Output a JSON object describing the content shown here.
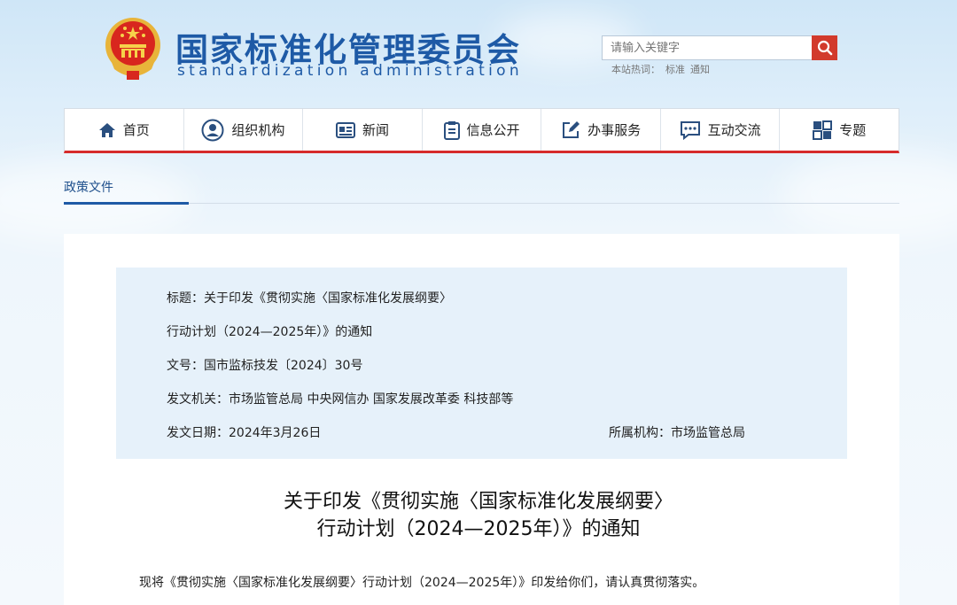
{
  "header": {
    "site_title": "国家标准化管理委员会",
    "site_subtitle": "standardization administration",
    "search_placeholder": "请输入关键字",
    "hot_label": "本站热词：",
    "hot_words": [
      "标准",
      "通知"
    ]
  },
  "nav": {
    "items": [
      {
        "label": "首页",
        "icon": "home-icon"
      },
      {
        "label": "组织机构",
        "icon": "user-circle-icon"
      },
      {
        "label": "新闻",
        "icon": "newspaper-icon"
      },
      {
        "label": "信息公开",
        "icon": "clipboard-icon"
      },
      {
        "label": "办事服务",
        "icon": "edit-icon"
      },
      {
        "label": "互动交流",
        "icon": "chat-icon"
      },
      {
        "label": "专题",
        "icon": "puzzle-icon"
      }
    ]
  },
  "breadcrumb": {
    "label": "政策文件"
  },
  "meta": {
    "title_label": "标题：",
    "title_line1": "关于印发《贯彻实施〈国家标准化发展纲要〉",
    "title_line2": "行动计划（2024—2025年）》的通知",
    "docno_label": "文号：",
    "docno": "国市监标技发〔2024〕30号",
    "issuer_label": "发文机关：",
    "issuer": "市场监管总局 中央网信办 国家发展改革委 科技部等",
    "date_label": "发文日期：",
    "date": "2024年3月26日",
    "org_label": "所属机构：",
    "org": "市场监管总局"
  },
  "document": {
    "title_line1": "关于印发《贯彻实施〈国家标准化发展纲要〉",
    "title_line2": "行动计划（2024—2025年）》的通知",
    "body": "现将《贯彻实施〈国家标准化发展纲要〉行动计划（2024—2025年）》印发给你们，请认真贯彻落实。"
  },
  "colors": {
    "brand_blue": "#1e5aa6",
    "accent_red": "#d62b2b",
    "meta_bg": "#e6f1fa"
  }
}
